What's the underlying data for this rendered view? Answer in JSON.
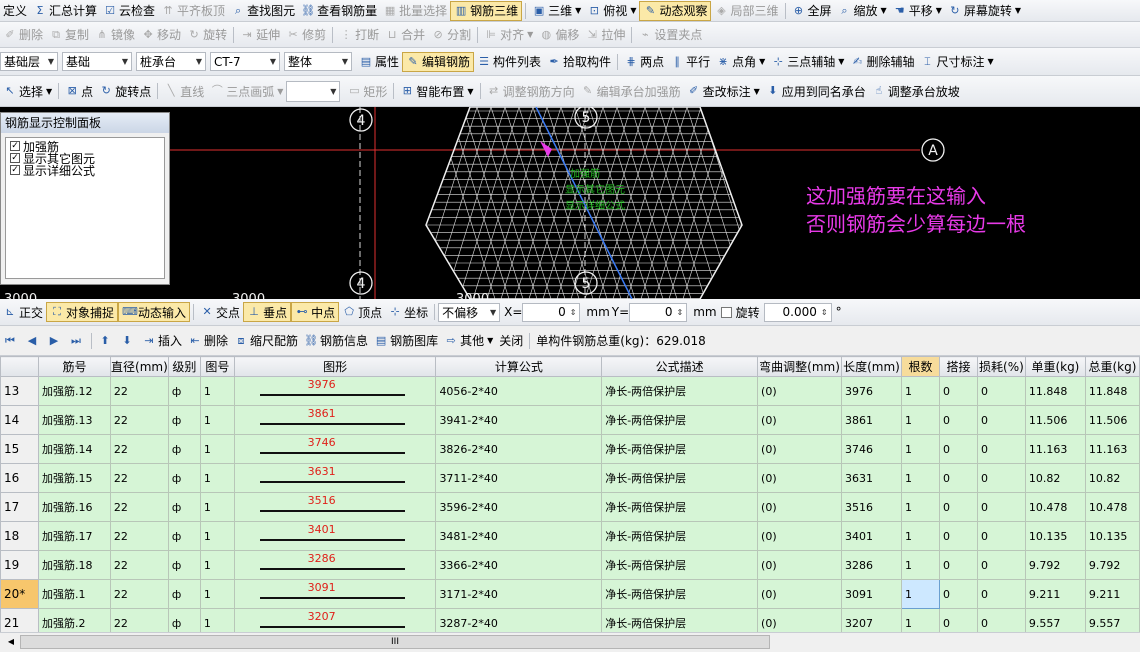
{
  "toolbar1": [
    "定义",
    "汇总计算",
    "云检查",
    "平齐板顶",
    "查找图元",
    "查看钢筋量",
    "批量选择",
    "钢筋三维",
    "三维",
    "俯视",
    "动态观察",
    "局部三维",
    "全屏",
    "缩放",
    "平移",
    "屏幕旋转"
  ],
  "toolbar2": [
    "删除",
    "复制",
    "镜像",
    "移动",
    "旋转",
    "延伸",
    "修剪",
    "打断",
    "合并",
    "分割",
    "对齐",
    "偏移",
    "拉伸",
    "设置夹点"
  ],
  "toolbar3": {
    "dropdowns": [
      "基础层",
      "基础",
      "桩承台",
      "CT-7",
      "整体"
    ],
    "buttons": [
      "属性",
      "编辑钢筋",
      "构件列表",
      "拾取构件",
      "两点",
      "平行",
      "点角",
      "三点辅轴",
      "删除辅轴",
      "尺寸标注"
    ]
  },
  "toolbar4": [
    "选择",
    "点",
    "旋转点",
    "直线",
    "三点画弧",
    "矩形",
    "智能布置",
    "调整钢筋方向",
    "编辑承台加强筋",
    "查改标注",
    "应用到同名承台",
    "调整承台放坡"
  ],
  "panel": {
    "title": "钢筋显示控制面板",
    "items": [
      "加强筋",
      "显示其它图元",
      "显示详细公式"
    ]
  },
  "cad": {
    "axis_labels": [
      "4",
      "5",
      "A",
      "4",
      "5"
    ],
    "dims": [
      "3000",
      "3000",
      "3000"
    ],
    "overlay_text": [
      "加强筋",
      "显示其它图元",
      "显示详细公式"
    ]
  },
  "annotation": {
    "line1": "这加强筋要在这输入",
    "line2": "否则钢筋会少算每边一根"
  },
  "snapbar": {
    "items": [
      "正交",
      "对象捕捉",
      "动态输入",
      "交点",
      "垂点",
      "中点",
      "顶点",
      "坐标",
      "不偏移"
    ],
    "x_label": "X=",
    "x_value": "0",
    "mm1": "mm",
    "y_label": "Y=",
    "y_value": "0",
    "mm2": "mm",
    "rotate_label": "旋转",
    "rotate_value": "0.000",
    "deg": "°"
  },
  "gridbar": {
    "buttons": [
      "插入",
      "删除",
      "缩尺配筋",
      "钢筋信息",
      "钢筋图库",
      "其他",
      "关闭"
    ],
    "total": "单构件钢筋总重(kg)：629.018"
  },
  "table": {
    "columns": [
      "",
      "筋号",
      "直径(mm)",
      "级别",
      "图号",
      "图形",
      "计算公式",
      "公式描述",
      "弯曲调整(mm)",
      "长度(mm)",
      "根数",
      "搭接",
      "损耗(%)",
      "单重(kg)",
      "总重(kg)"
    ],
    "rows": [
      {
        "idx": "13",
        "name": "加强筋.12",
        "dia": "22",
        "grade": "ф",
        "fig": "1",
        "shape": "3976",
        "formula": "4056-2*40",
        "desc": "净长-两倍保护层",
        "bend": "(0)",
        "len": "3976",
        "count": "1",
        "lap": "0",
        "loss": "0",
        "unit": "11.848",
        "total": "11.848"
      },
      {
        "idx": "14",
        "name": "加强筋.13",
        "dia": "22",
        "grade": "ф",
        "fig": "1",
        "shape": "3861",
        "formula": "3941-2*40",
        "desc": "净长-两倍保护层",
        "bend": "(0)",
        "len": "3861",
        "count": "1",
        "lap": "0",
        "loss": "0",
        "unit": "11.506",
        "total": "11.506"
      },
      {
        "idx": "15",
        "name": "加强筋.14",
        "dia": "22",
        "grade": "ф",
        "fig": "1",
        "shape": "3746",
        "formula": "3826-2*40",
        "desc": "净长-两倍保护层",
        "bend": "(0)",
        "len": "3746",
        "count": "1",
        "lap": "0",
        "loss": "0",
        "unit": "11.163",
        "total": "11.163"
      },
      {
        "idx": "16",
        "name": "加强筋.15",
        "dia": "22",
        "grade": "ф",
        "fig": "1",
        "shape": "3631",
        "formula": "3711-2*40",
        "desc": "净长-两倍保护层",
        "bend": "(0)",
        "len": "3631",
        "count": "1",
        "lap": "0",
        "loss": "0",
        "unit": "10.82",
        "total": "10.82"
      },
      {
        "idx": "17",
        "name": "加强筋.16",
        "dia": "22",
        "grade": "ф",
        "fig": "1",
        "shape": "3516",
        "formula": "3596-2*40",
        "desc": "净长-两倍保护层",
        "bend": "(0)",
        "len": "3516",
        "count": "1",
        "lap": "0",
        "loss": "0",
        "unit": "10.478",
        "total": "10.478"
      },
      {
        "idx": "18",
        "name": "加强筋.17",
        "dia": "22",
        "grade": "ф",
        "fig": "1",
        "shape": "3401",
        "formula": "3481-2*40",
        "desc": "净长-两倍保护层",
        "bend": "(0)",
        "len": "3401",
        "count": "1",
        "lap": "0",
        "loss": "0",
        "unit": "10.135",
        "total": "10.135"
      },
      {
        "idx": "19",
        "name": "加强筋.18",
        "dia": "22",
        "grade": "ф",
        "fig": "1",
        "shape": "3286",
        "formula": "3366-2*40",
        "desc": "净长-两倍保护层",
        "bend": "(0)",
        "len": "3286",
        "count": "1",
        "lap": "0",
        "loss": "0",
        "unit": "9.792",
        "total": "9.792"
      },
      {
        "idx": "20*",
        "name": "加强筋.1",
        "dia": "22",
        "grade": "ф",
        "fig": "1",
        "shape": "3091",
        "formula": "3171-2*40",
        "desc": "净长-两倍保护层",
        "bend": "(0)",
        "len": "3091",
        "count": "1",
        "lap": "0",
        "loss": "0",
        "unit": "9.211",
        "total": "9.211"
      },
      {
        "idx": "21",
        "name": "加强筋.2",
        "dia": "22",
        "grade": "ф",
        "fig": "1",
        "shape": "3207",
        "formula": "3287-2*40",
        "desc": "净长-两倍保护层",
        "bend": "(0)",
        "len": "3207",
        "count": "1",
        "lap": "0",
        "loss": "0",
        "unit": "9.557",
        "total": "9.557"
      }
    ]
  },
  "scroll": {
    "grip": "III"
  },
  "colors": {
    "highlight": "#e83ae8",
    "grid_green": "#d6f5d6",
    "shape_text": "#e0201a",
    "current_row": "#f7c66c"
  }
}
